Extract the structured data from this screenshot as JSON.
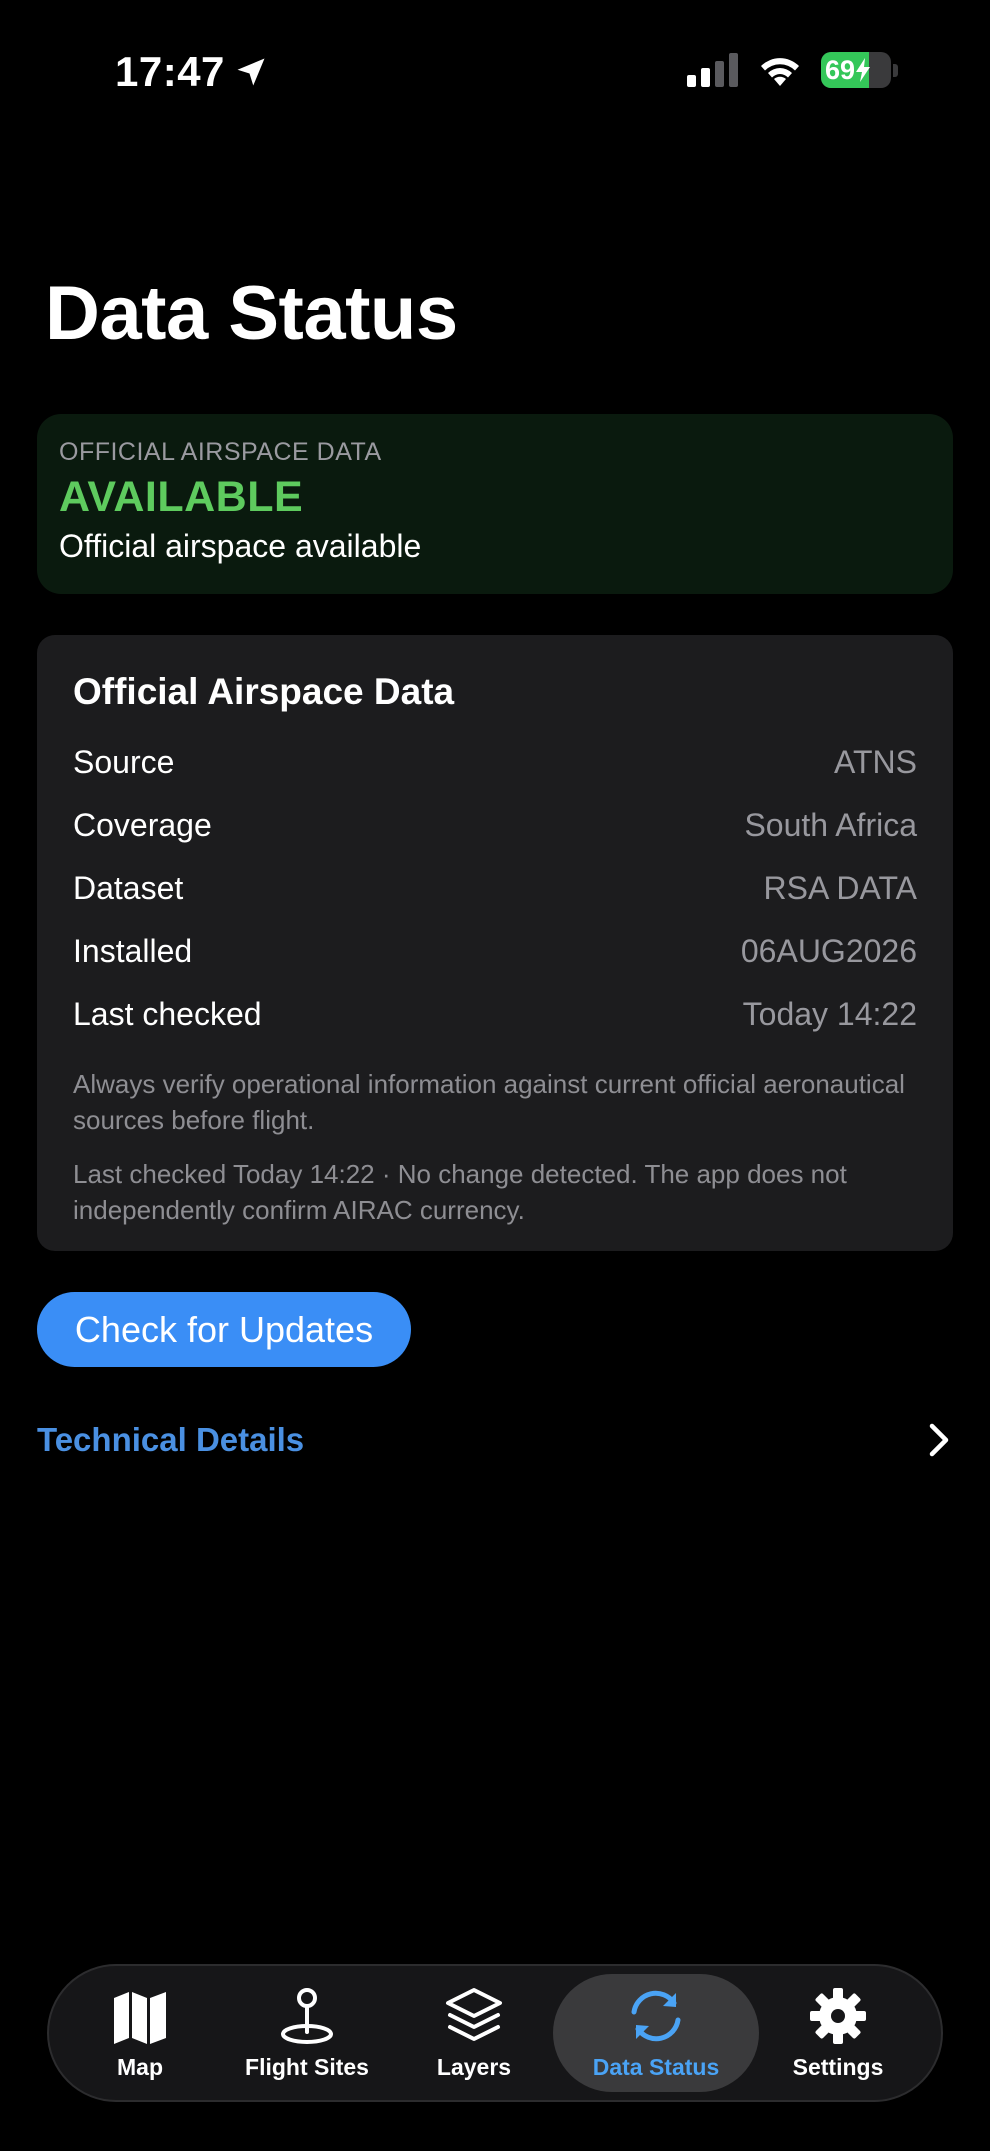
{
  "status_bar": {
    "time": "17:47",
    "battery": "69",
    "battery_level_percent": 69,
    "icons": [
      "location-arrow-icon",
      "cellular-signal-icon",
      "wifi-icon",
      "battery-charging-icon"
    ]
  },
  "page": {
    "title": "Data Status"
  },
  "banner": {
    "label": "OFFICIAL AIRSPACE DATA",
    "status": "AVAILABLE",
    "subtitle": "Official airspace available",
    "status_color": "#5ecb5e"
  },
  "card": {
    "title": "Official Airspace Data",
    "rows": [
      {
        "key": "Source",
        "value": "ATNS"
      },
      {
        "key": "Coverage",
        "value": "South Africa"
      },
      {
        "key": "Dataset",
        "value": "RSA DATA"
      },
      {
        "key": "Installed",
        "value": "06AUG2026"
      },
      {
        "key": "Last checked",
        "value": "Today 14:22"
      }
    ],
    "note_1": "Always verify operational information against current official aeronautical sources before flight.",
    "note_2": "Last checked Today 14:22 · No change detected. The app does not independently confirm AIRAC currency."
  },
  "actions": {
    "check_updates_label": "Check for Updates",
    "technical_details_label": "Technical Details"
  },
  "tab_bar": {
    "tabs": [
      {
        "label": "Map",
        "icon": "map-icon"
      },
      {
        "label": "Flight Sites",
        "icon": "flight-site-pin-icon"
      },
      {
        "label": "Layers",
        "icon": "layers-icon"
      },
      {
        "label": "Data Status",
        "icon": "sync-icon",
        "active": true
      },
      {
        "label": "Settings",
        "icon": "gear-icon"
      }
    ]
  },
  "colors": {
    "accent": "#3a8ef6",
    "link": "#4a90e2",
    "active_tab": "#4aa3f5",
    "available": "#5ecb5e"
  }
}
